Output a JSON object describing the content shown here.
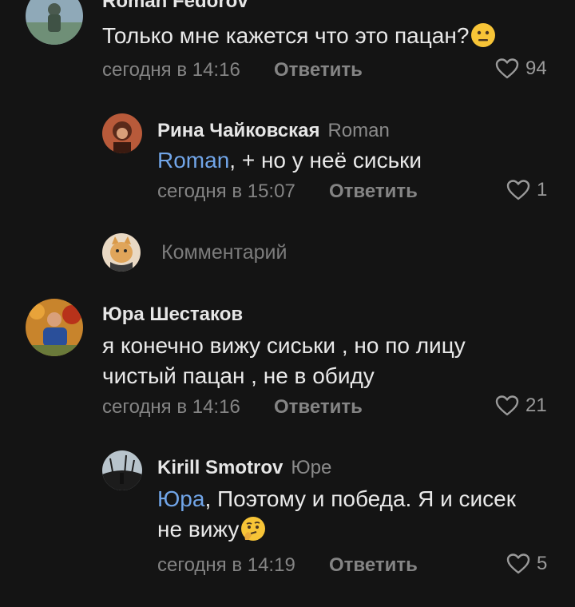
{
  "comments": [
    {
      "author": "Roman Fedorov",
      "text": "Только мне кажется что это пацан?",
      "emoji": "neutral-face",
      "time": "сегодня в 14:16",
      "reply_label": "Ответить",
      "likes": "94"
    },
    {
      "author": "Рина Чайковская",
      "reply_to": "Roman",
      "mention": "Roman",
      "text": ", + но у неё  сиськи",
      "time": "сегодня в 15:07",
      "reply_label": "Ответить",
      "likes": "1"
    },
    {
      "author": "Юра Шестаков",
      "text_line1": "я конечно вижу сиськи , но по лицу",
      "text_line2": "чистый пацан , не в обиду",
      "time": "сегодня в 14:16",
      "reply_label": "Ответить",
      "likes": "21"
    },
    {
      "author": "Kirill Smotrov",
      "reply_to": "Юре",
      "mention": "Юра",
      "text_line1": ", Поэтому и победа. Я и сисек",
      "text_line2": "не вижу",
      "emoji": "thinking-face",
      "time": "сегодня в 14:19",
      "reply_label": "Ответить",
      "likes": "5"
    }
  ],
  "composer": {
    "placeholder": "Комментарий"
  },
  "colors": {
    "background": "#141414",
    "mention": "#71a5e8",
    "muted": "#848484"
  }
}
